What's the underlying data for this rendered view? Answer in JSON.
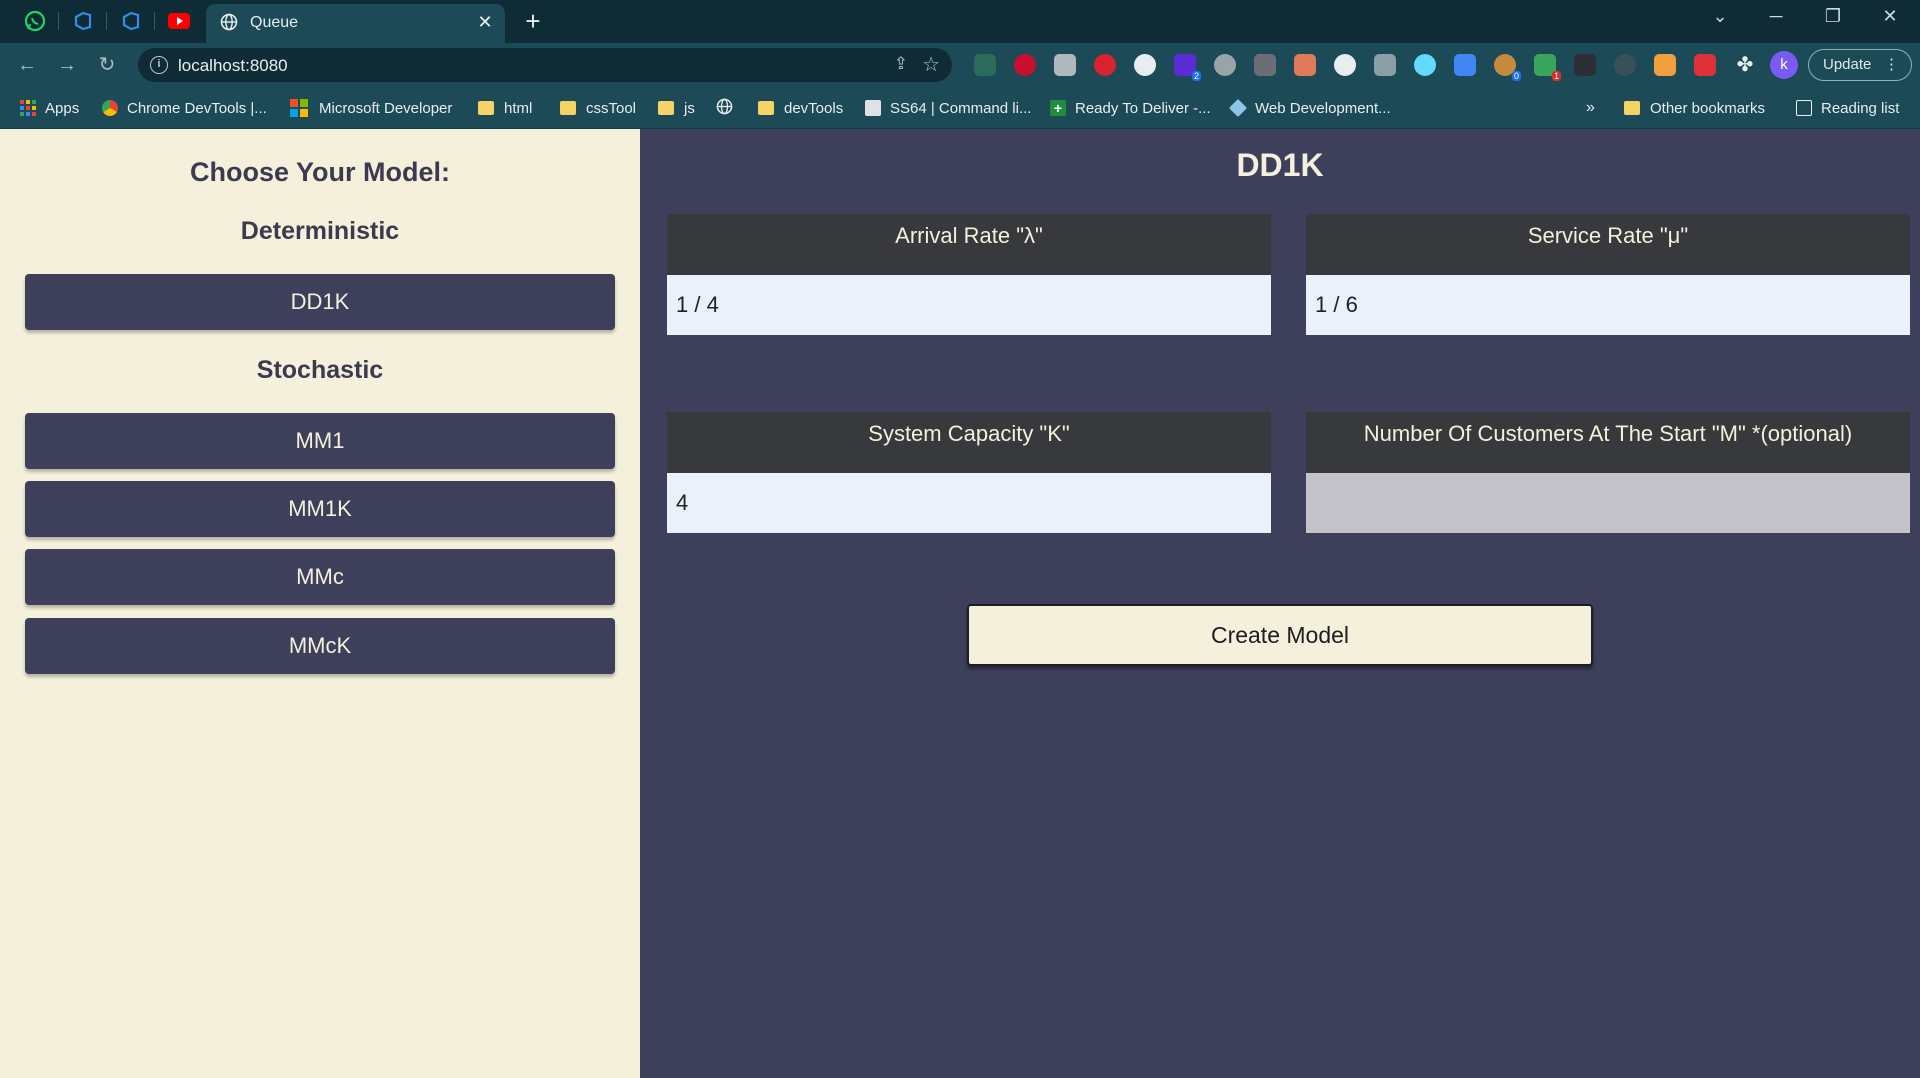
{
  "browser": {
    "tab_title": "Queue",
    "url": "localhost:8080",
    "profile_initial": "k",
    "update_label": "Update",
    "bookmarks": [
      {
        "label": "Apps",
        "icon": "apps-grid-icon"
      },
      {
        "label": "Chrome DevTools |...",
        "icon": "chrome-icon"
      },
      {
        "label": "Microsoft Developer",
        "icon": "microsoft-icon"
      },
      {
        "label": "html",
        "icon": "folder-icon"
      },
      {
        "label": "cssTool",
        "icon": "folder-icon"
      },
      {
        "label": "js",
        "icon": "folder-icon"
      },
      {
        "label": "",
        "icon": "globe-icon"
      },
      {
        "label": "devTools",
        "icon": "folder-icon"
      },
      {
        "label": "SS64 | Command li...",
        "icon": "page-icon"
      },
      {
        "label": "Ready To Deliver -...",
        "icon": "plus-icon"
      },
      {
        "label": "Web Development...",
        "icon": "cube-icon"
      }
    ],
    "more_bookmarks": "»",
    "other_bookmarks": "Other bookmarks",
    "reading_list": "Reading list"
  },
  "sidebar": {
    "heading": "Choose Your Model:",
    "deterministic_heading": "Deterministic",
    "deterministic_models": [
      "DD1K"
    ],
    "stochastic_heading": "Stochastic",
    "stochastic_models": [
      "MM1",
      "MM1K",
      "MMc",
      "MMcK"
    ]
  },
  "main": {
    "title": "DD1K",
    "fields": {
      "arrival_rate": {
        "label": "Arrival Rate \"λ\"",
        "value": "1 / 4"
      },
      "service_rate": {
        "label": "Service Rate \"μ\"",
        "value": "1 / 6"
      },
      "system_capacity": {
        "label": "System Capacity \"K\"",
        "value": "4"
      },
      "initial_customers": {
        "label": "Number Of Customers At The Start \"M\" *(optional)",
        "value": ""
      }
    },
    "create_button": "Create Model"
  },
  "colors": {
    "sidebar_bg": "#f4f0dc",
    "main_bg": "#3d3f5b",
    "button_bg": "#3d3f5b",
    "label_bg": "#37393d",
    "browser_frame": "#0f2c36",
    "browser_toolbar": "#1c4a56"
  }
}
